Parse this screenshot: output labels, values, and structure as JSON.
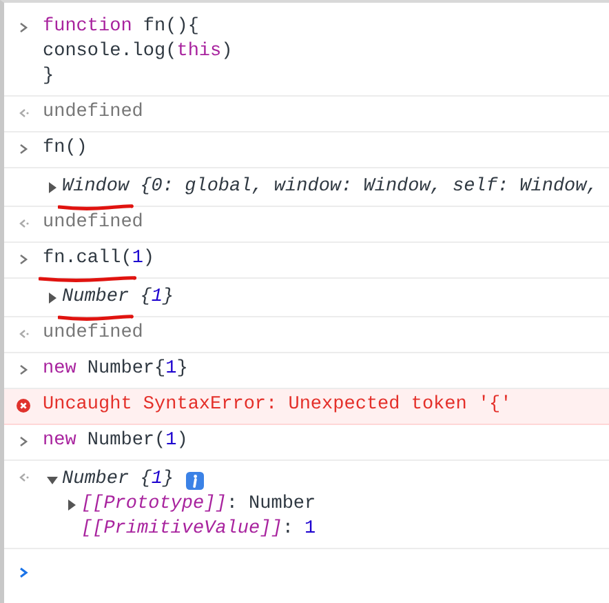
{
  "entries": [
    {
      "kind": "input",
      "underlined": false,
      "lines": [
        [
          {
            "t": "function",
            "kind": "keyword"
          },
          {
            "t": " fn(){",
            "kind": "plain"
          }
        ],
        [
          {
            "t": "console.log(",
            "kind": "plain"
          },
          {
            "t": "this",
            "kind": "keyword"
          },
          {
            "t": ")",
            "kind": "plain"
          }
        ],
        [
          {
            "t": "}",
            "kind": "plain"
          }
        ]
      ]
    },
    {
      "kind": "result",
      "text": "undefined"
    },
    {
      "kind": "input",
      "underlined": false,
      "lines": [
        [
          {
            "t": "fn()",
            "kind": "plain"
          }
        ]
      ]
    },
    {
      "kind": "object",
      "returned": false,
      "expanded": false,
      "underlined": true,
      "info": false,
      "tokens": [
        {
          "t": "Window",
          "kind": "plain"
        },
        {
          "t": " {0: global, window: Window, self: Window,",
          "kind": "plain"
        }
      ]
    },
    {
      "kind": "result",
      "text": "undefined"
    },
    {
      "kind": "input",
      "underlined": true,
      "lines": [
        [
          {
            "t": "fn.call(",
            "kind": "plain"
          },
          {
            "t": "1",
            "kind": "number"
          },
          {
            "t": ")",
            "kind": "plain"
          }
        ]
      ]
    },
    {
      "kind": "object",
      "returned": false,
      "expanded": false,
      "underlined": true,
      "info": false,
      "tokens": [
        {
          "t": "Number",
          "kind": "plain"
        },
        {
          "t": " {",
          "kind": "plain"
        },
        {
          "t": "1",
          "kind": "number"
        },
        {
          "t": "}",
          "kind": "plain"
        }
      ]
    },
    {
      "kind": "result",
      "text": "undefined"
    },
    {
      "kind": "input",
      "underlined": false,
      "lines": [
        [
          {
            "t": "new",
            "kind": "keyword"
          },
          {
            "t": " Number{",
            "kind": "plain"
          },
          {
            "t": "1",
            "kind": "number"
          },
          {
            "t": "}",
            "kind": "plain"
          }
        ]
      ]
    },
    {
      "kind": "error",
      "text": "Uncaught SyntaxError: Unexpected token '{'"
    },
    {
      "kind": "input",
      "underlined": false,
      "lines": [
        [
          {
            "t": "new",
            "kind": "keyword"
          },
          {
            "t": " Number(",
            "kind": "plain"
          },
          {
            "t": "1",
            "kind": "number"
          },
          {
            "t": ")",
            "kind": "plain"
          }
        ]
      ]
    },
    {
      "kind": "object",
      "returned": true,
      "expanded": true,
      "underlined": false,
      "info": true,
      "tokens": [
        {
          "t": "Number",
          "kind": "plain"
        },
        {
          "t": " {",
          "kind": "plain"
        },
        {
          "t": "1",
          "kind": "number"
        },
        {
          "t": "}",
          "kind": "plain"
        }
      ],
      "children": [
        {
          "expandable": true,
          "tokens": [
            {
              "t": "[[Prototype]]",
              "kind": "prop"
            },
            {
              "t": ": Number",
              "kind": "plain"
            }
          ]
        },
        {
          "expandable": false,
          "tokens": [
            {
              "t": "[[PrimitiveValue]]",
              "kind": "prop"
            },
            {
              "t": ": ",
              "kind": "plain"
            },
            {
              "t": "1",
              "kind": "number"
            }
          ]
        }
      ]
    },
    {
      "kind": "prompt"
    }
  ]
}
